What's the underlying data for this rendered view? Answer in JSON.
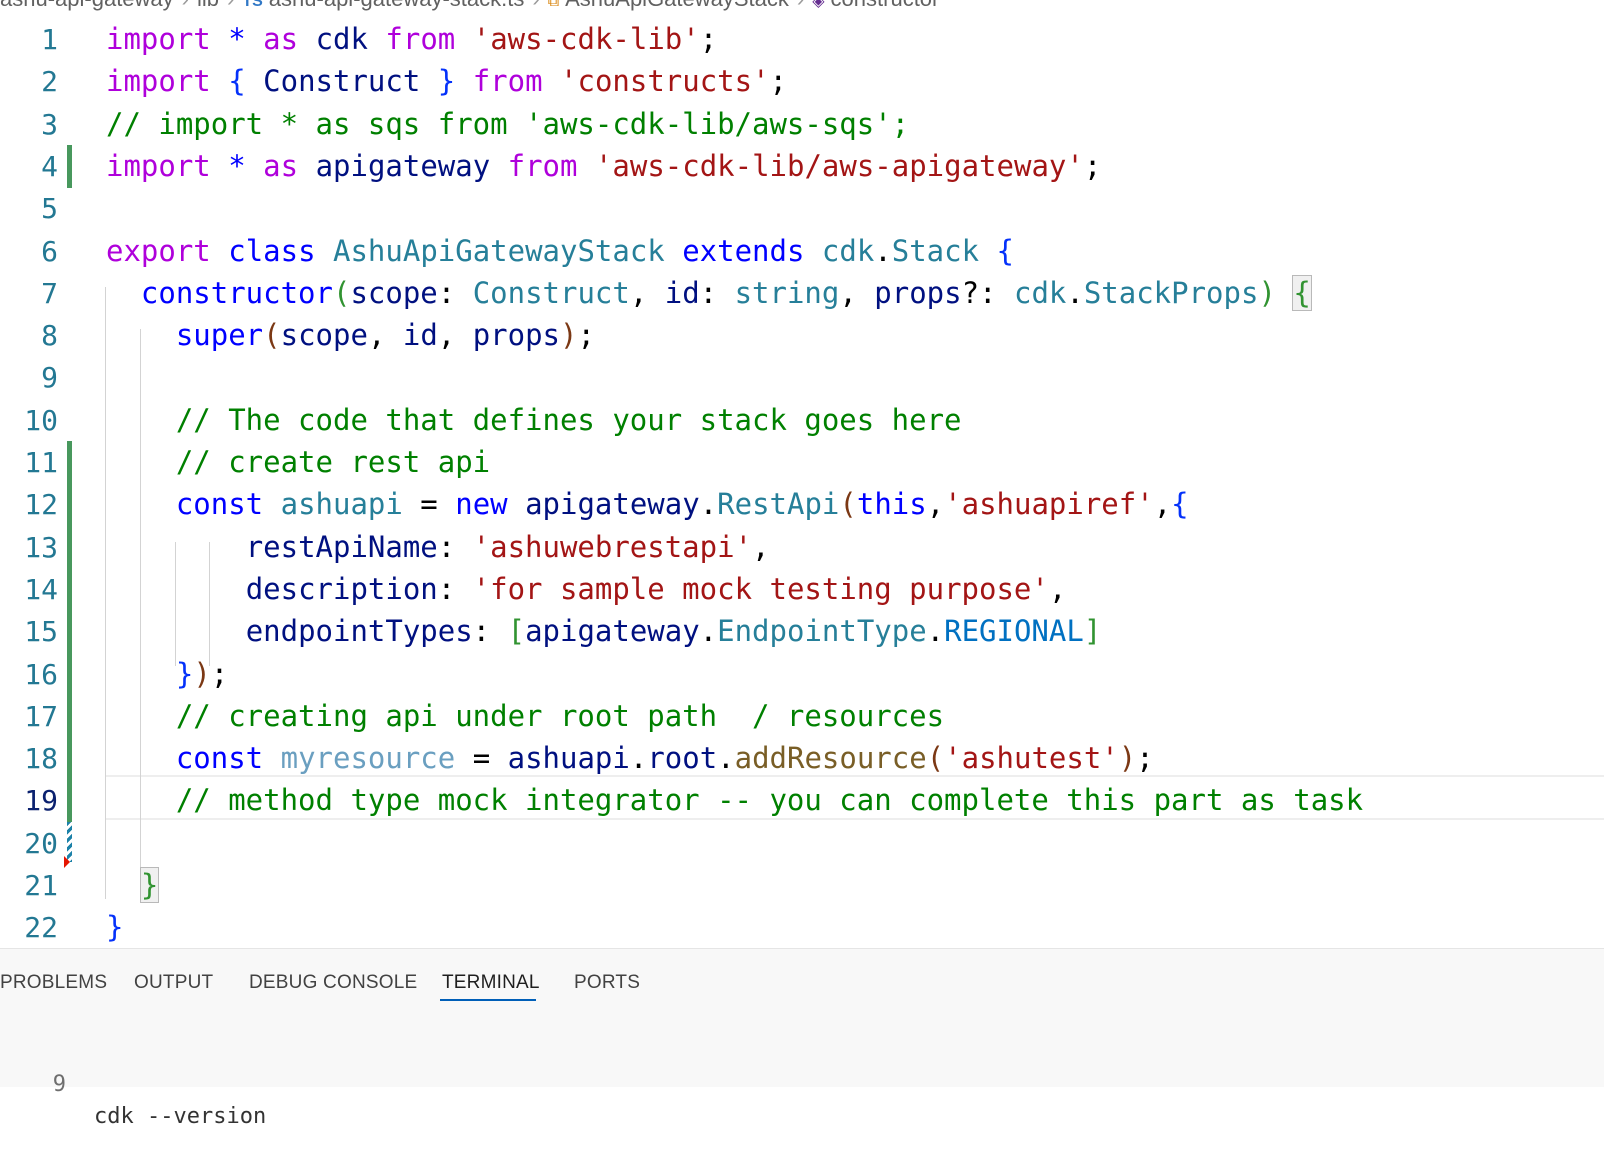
{
  "breadcrumb": {
    "folder": "ashu-api-gateway",
    "subfolder": "lib",
    "file": "ashu-api-gateway-stack.ts",
    "file_icon": "TS",
    "class_name": "AshuApiGatewayStack",
    "member": "constructor"
  },
  "editor": {
    "active_line": 19,
    "line_numbers": [
      "1",
      "2",
      "3",
      "4",
      "5",
      "6",
      "7",
      "8",
      "9",
      "10",
      "11",
      "12",
      "13",
      "14",
      "15",
      "16",
      "17",
      "18",
      "19",
      "20",
      "21",
      "22"
    ],
    "lines": [
      [
        [
          "kw",
          "import"
        ],
        [
          "pu",
          " "
        ],
        [
          "kb",
          "*"
        ],
        [
          "pu",
          " "
        ],
        [
          "kw",
          "as"
        ],
        [
          "pu",
          " "
        ],
        [
          "vr",
          "cdk"
        ],
        [
          "pu",
          " "
        ],
        [
          "kw",
          "from"
        ],
        [
          "pu",
          " "
        ],
        [
          "st",
          "'aws-cdk-lib'"
        ],
        [
          "pu",
          ";"
        ]
      ],
      [
        [
          "kw",
          "import"
        ],
        [
          "pu",
          " "
        ],
        [
          "b1",
          "{"
        ],
        [
          "pu",
          " "
        ],
        [
          "vr",
          "Construct"
        ],
        [
          "pu",
          " "
        ],
        [
          "b1",
          "}"
        ],
        [
          "pu",
          " "
        ],
        [
          "kw",
          "from"
        ],
        [
          "pu",
          " "
        ],
        [
          "st",
          "'constructs'"
        ],
        [
          "pu",
          ";"
        ]
      ],
      [
        [
          "cm",
          "// import * as sqs from 'aws-cdk-lib/aws-sqs';"
        ]
      ],
      [
        [
          "kw",
          "import"
        ],
        [
          "pu",
          " "
        ],
        [
          "kb",
          "*"
        ],
        [
          "pu",
          " "
        ],
        [
          "kw",
          "as"
        ],
        [
          "pu",
          " "
        ],
        [
          "vr",
          "apigateway"
        ],
        [
          "pu",
          " "
        ],
        [
          "kw",
          "from"
        ],
        [
          "pu",
          " "
        ],
        [
          "st",
          "'aws-cdk-lib/aws-apigateway'"
        ],
        [
          "pu",
          ";"
        ]
      ],
      [],
      [
        [
          "kw",
          "export"
        ],
        [
          "pu",
          " "
        ],
        [
          "kb",
          "class"
        ],
        [
          "pu",
          " "
        ],
        [
          "ty",
          "AshuApiGatewayStack"
        ],
        [
          "pu",
          " "
        ],
        [
          "kb",
          "extends"
        ],
        [
          "pu",
          " "
        ],
        [
          "ty",
          "cdk"
        ],
        [
          "pu",
          "."
        ],
        [
          "ty",
          "Stack"
        ],
        [
          "pu",
          " "
        ],
        [
          "b1",
          "{"
        ]
      ],
      [
        [
          "pu",
          "  "
        ],
        [
          "kb",
          "constructor"
        ],
        [
          "b2",
          "("
        ],
        [
          "vr",
          "scope"
        ],
        [
          "pu",
          ": "
        ],
        [
          "ty",
          "Construct"
        ],
        [
          "pu",
          ", "
        ],
        [
          "vr",
          "id"
        ],
        [
          "pu",
          ": "
        ],
        [
          "ty",
          "string"
        ],
        [
          "pu",
          ", "
        ],
        [
          "vr",
          "props"
        ],
        [
          "pu",
          "?: "
        ],
        [
          "ty",
          "cdk"
        ],
        [
          "pu",
          "."
        ],
        [
          "ty",
          "StackProps"
        ],
        [
          "b2",
          ")"
        ],
        [
          "pu",
          " "
        ],
        [
          "b2",
          "{"
        ]
      ],
      [
        [
          "pu",
          "    "
        ],
        [
          "kb",
          "super"
        ],
        [
          "b3",
          "("
        ],
        [
          "vr",
          "scope"
        ],
        [
          "pu",
          ", "
        ],
        [
          "vr",
          "id"
        ],
        [
          "pu",
          ", "
        ],
        [
          "vr",
          "props"
        ],
        [
          "b3",
          ")"
        ],
        [
          "pu",
          ";"
        ]
      ],
      [],
      [
        [
          "pu",
          "    "
        ],
        [
          "cm",
          "// The code that defines your stack goes here"
        ]
      ],
      [
        [
          "pu",
          "    "
        ],
        [
          "cm",
          "// create rest api"
        ]
      ],
      [
        [
          "pu",
          "    "
        ],
        [
          "kb",
          "const"
        ],
        [
          "pu",
          " "
        ],
        [
          "ty",
          "ashuapi"
        ],
        [
          "pu",
          " = "
        ],
        [
          "kb",
          "new"
        ],
        [
          "pu",
          " "
        ],
        [
          "vr",
          "apigateway"
        ],
        [
          "pu",
          "."
        ],
        [
          "ty",
          "RestApi"
        ],
        [
          "b3",
          "("
        ],
        [
          "kb",
          "this"
        ],
        [
          "pu",
          ","
        ],
        [
          "st",
          "'ashuapiref'"
        ],
        [
          "pu",
          ","
        ],
        [
          "b1",
          "{"
        ]
      ],
      [
        [
          "pu",
          "        "
        ],
        [
          "vr",
          "restApiName"
        ],
        [
          "pu",
          ": "
        ],
        [
          "st",
          "'ashuwebrestapi'"
        ],
        [
          "pu",
          ","
        ]
      ],
      [
        [
          "pu",
          "        "
        ],
        [
          "vr",
          "description"
        ],
        [
          "pu",
          ": "
        ],
        [
          "st",
          "'for sample mock testing purpose'"
        ],
        [
          "pu",
          ","
        ]
      ],
      [
        [
          "pu",
          "        "
        ],
        [
          "vr",
          "endpointTypes"
        ],
        [
          "pu",
          ": "
        ],
        [
          "b2",
          "["
        ],
        [
          "vr",
          "apigateway"
        ],
        [
          "pu",
          "."
        ],
        [
          "ty",
          "EndpointType"
        ],
        [
          "pu",
          "."
        ],
        [
          "cn",
          "REGIONAL"
        ],
        [
          "b2",
          "]"
        ]
      ],
      [
        [
          "pu",
          "    "
        ],
        [
          "b1",
          "}"
        ],
        [
          "b3",
          ")"
        ],
        [
          "pu",
          ";"
        ]
      ],
      [
        [
          "pu",
          "    "
        ],
        [
          "cm",
          "// creating api under root path  / resources"
        ]
      ],
      [
        [
          "pu",
          "    "
        ],
        [
          "kb",
          "const"
        ],
        [
          "pu",
          " "
        ],
        [
          "uv",
          "myresource"
        ],
        [
          "pu",
          " = "
        ],
        [
          "vr",
          "ashuapi"
        ],
        [
          "pu",
          "."
        ],
        [
          "vr",
          "root"
        ],
        [
          "pu",
          "."
        ],
        [
          "fn",
          "addResource"
        ],
        [
          "b3",
          "("
        ],
        [
          "st",
          "'ashutest'"
        ],
        [
          "b3",
          ")"
        ],
        [
          "pu",
          ";"
        ]
      ],
      [
        [
          "pu",
          "    "
        ],
        [
          "cm",
          "// method type mock integrator -- you can complete this part as task"
        ]
      ],
      [],
      [
        [
          "pu",
          "  "
        ],
        [
          "b2",
          "}"
        ]
      ],
      [
        [
          "b1",
          "}"
        ]
      ]
    ]
  },
  "panel": {
    "tabs": [
      "PROBLEMS",
      "OUTPUT",
      "DEBUG CONSOLE",
      "TERMINAL",
      "PORTS"
    ],
    "active_tab": "TERMINAL",
    "terminal_line": {
      "number": "9",
      "command": "cdk --version"
    }
  },
  "colors": {
    "keyword_control": "#af00db",
    "keyword": "#0000ff",
    "string": "#a31515",
    "comment": "#008000",
    "type": "#267f99",
    "variable": "#001080",
    "gutter_modified": "#48985d",
    "line_number": "#237893",
    "tab_active_underline": "#005fb8"
  }
}
